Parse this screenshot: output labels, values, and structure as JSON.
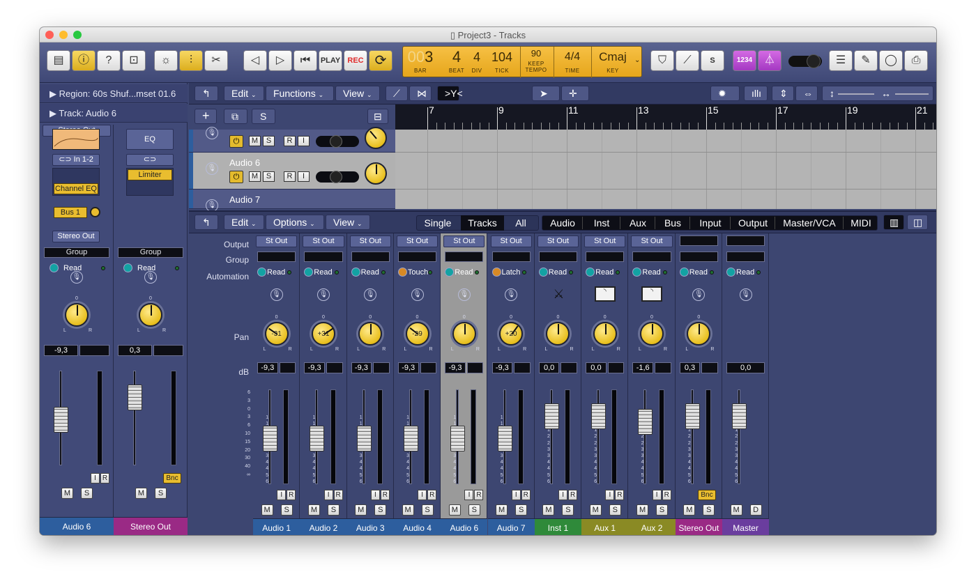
{
  "window": {
    "title": "Project3 - Tracks",
    "traffic": {
      "close": "#ff5f57",
      "min": "#febc2e",
      "max": "#28c840"
    }
  },
  "toolbar": {
    "left": [
      {
        "name": "library-button",
        "glyph": "▤",
        "on": false
      },
      {
        "name": "inspector-button",
        "glyph": "ⓘ",
        "on": true
      },
      {
        "name": "quick-help-button",
        "glyph": "?",
        "on": false
      },
      {
        "name": "toolbar-button",
        "glyph": "⊡",
        "on": false
      }
    ],
    "edit": [
      {
        "name": "smart-controls-button",
        "glyph": "☼",
        "on": false
      },
      {
        "name": "mixer-button",
        "glyph": "⫶",
        "on": true
      },
      {
        "name": "editors-button",
        "glyph": "✂",
        "on": false
      }
    ],
    "transport": {
      "rewind": "◁",
      "forward": "▷",
      "to_start": "⏮",
      "play": "PLAY",
      "rec": "REC",
      "cycle": "⟳"
    },
    "lcd": {
      "bar": "3",
      "bar_dim": "00",
      "beat": "4",
      "div": "4",
      "tick": "104",
      "tempo_value": "90",
      "tempo_mode": "KEEP",
      "time_sig": "4/4",
      "key": "Cmaj",
      "labels": {
        "bar": "BAR",
        "beat": "BEAT",
        "div": "DIV",
        "tick": "TICK",
        "tempo": "TEMPO",
        "time": "TIME",
        "key": "KEY"
      }
    },
    "right": {
      "count_in": "1234"
    }
  },
  "inspector": {
    "region": "Region:  60s Shuf...mset 01.6",
    "track": "Track:  Audio 6"
  },
  "inspector_strips": [
    {
      "name": "Audio 6",
      "color": "#2d5e9e",
      "input": "In 1-2",
      "plugin": "Channel EQ",
      "send": "Bus 1",
      "output": "Stereo Out",
      "group": "Group",
      "automation": "Read",
      "db": "-9,3",
      "fader": 0.52,
      "pan": 0,
      "buttons": [
        "M",
        "S"
      ]
    },
    {
      "name": "Stereo Out",
      "color": "#9a2a85",
      "input": "",
      "eq": "EQ",
      "plugin": "Limiter",
      "send": "",
      "output": "",
      "group": "Group",
      "automation": "Read",
      "db": "0,3",
      "fader": 0.78,
      "pan": 0,
      "buttons": [
        "M",
        "S"
      ],
      "bnc": "Bnc"
    }
  ],
  "tracks": {
    "menus": [
      "Edit",
      "Functions",
      "View"
    ],
    "buttons": {
      "add": "+",
      "dup": "⧉",
      "solo": "S"
    },
    "ruler": [
      "7",
      "9",
      "11",
      "13",
      "15",
      "17",
      "19",
      "21"
    ],
    "rows": [
      {
        "name": "",
        "selected": false
      },
      {
        "name": "Audio 6",
        "selected": true
      },
      {
        "name": "Audio 7",
        "selected": false
      }
    ],
    "row_buttons": [
      "M",
      "S",
      "R",
      "I"
    ]
  },
  "mixer": {
    "menus": [
      "Edit",
      "Options",
      "View"
    ],
    "modes": [
      "Single",
      "Tracks",
      "All"
    ],
    "active_mode": "Tracks",
    "filters": [
      "Audio",
      "Inst",
      "Aux",
      "Bus",
      "Input",
      "Output",
      "Master/VCA",
      "MIDI"
    ],
    "labels": {
      "output": "Output",
      "group": "Group",
      "automation": "Automation",
      "pan": "Pan",
      "db": "dB"
    },
    "scale_left": [
      "6",
      "3",
      "0",
      "3",
      "6",
      "10",
      "15",
      "20",
      "30",
      "40",
      "∞"
    ],
    "scale_meter": [
      "0",
      "3",
      "6",
      "9",
      "12",
      "15",
      "18",
      "21",
      "24",
      "30",
      "35",
      "40",
      "45",
      "50",
      "60"
    ],
    "channels": [
      {
        "name": "Audio 1",
        "color": "#2d5e9e",
        "output": "St Out",
        "automation": "Read",
        "auto_color": "#13a2a3",
        "pan": -31,
        "pan_label": "-31",
        "db": "-9,3",
        "fader": 0.52,
        "buttons": [
          "M",
          "S"
        ]
      },
      {
        "name": "Audio 2",
        "color": "#2d5e9e",
        "output": "St Out",
        "automation": "Read",
        "auto_color": "#13a2a3",
        "pan": 31,
        "pan_label": "+31",
        "db": "-9,3",
        "fader": 0.52,
        "buttons": [
          "M",
          "S"
        ]
      },
      {
        "name": "Audio 3",
        "color": "#2d5e9e",
        "output": "St Out",
        "automation": "Read",
        "auto_color": "#13a2a3",
        "pan": 0,
        "pan_label": "",
        "db": "-9,3",
        "fader": 0.52,
        "buttons": [
          "M",
          "S"
        ]
      },
      {
        "name": "Audio 4",
        "color": "#2d5e9e",
        "output": "St Out",
        "automation": "Touch",
        "auto_color": "#d88a25",
        "pan": -29,
        "pan_label": "-29",
        "db": "-9,3",
        "fader": 0.52,
        "buttons": [
          "M",
          "S"
        ]
      },
      {
        "name": "Audio 6",
        "color": "#2d5e9e",
        "output": "St Out",
        "automation": "Read",
        "auto_color": "#13a2a3",
        "pan": 0,
        "pan_label": "",
        "db": "-9,3",
        "fader": 0.52,
        "buttons": [
          "M",
          "S"
        ],
        "selected": true
      },
      {
        "name": "Audio 7",
        "color": "#2d5e9e",
        "output": "St Out",
        "automation": "Latch",
        "auto_color": "#d88a25",
        "pan": 20,
        "pan_label": "+20",
        "db": "-9,3",
        "fader": 0.52,
        "buttons": [
          "M",
          "S"
        ]
      },
      {
        "name": "Inst 1",
        "color": "#2f8a3a",
        "output": "St Out",
        "automation": "Read",
        "auto_color": "#13a2a3",
        "pan": 0,
        "pan_label": "",
        "db": "0,0",
        "fader": 0.78,
        "buttons": [
          "M",
          "S"
        ],
        "icon": "synth-icon"
      },
      {
        "name": "Aux 1",
        "color": "#8a8a24",
        "output": "St Out",
        "automation": "Read",
        "auto_color": "#13a2a3",
        "pan": 0,
        "pan_label": "",
        "db": "0,0",
        "fader": 0.78,
        "buttons": [
          "M",
          "S"
        ],
        "icon": "meter-icon"
      },
      {
        "name": "Aux 2",
        "color": "#8a8a24",
        "output": "St Out",
        "automation": "Read",
        "auto_color": "#13a2a3",
        "pan": 0,
        "pan_label": "",
        "db": "-1,6",
        "fader": 0.72,
        "buttons": [
          "M",
          "S"
        ],
        "icon": "meter-icon"
      },
      {
        "name": "Stereo Out",
        "color": "#9a2a85",
        "output": "",
        "automation": "Read",
        "auto_color": "#13a2a3",
        "pan": 0,
        "pan_label": "",
        "db": "0,3",
        "fader": 0.78,
        "buttons": [
          "M",
          "S"
        ],
        "bnc": "Bnc"
      },
      {
        "name": "Master",
        "color": "#6a3d9e",
        "output": "",
        "automation": "Read",
        "auto_color": "#13a2a3",
        "pan": null,
        "pan_label": "",
        "db": "0,0",
        "fader": 0.78,
        "buttons": [
          "M",
          "D"
        ],
        "master": true
      }
    ]
  }
}
